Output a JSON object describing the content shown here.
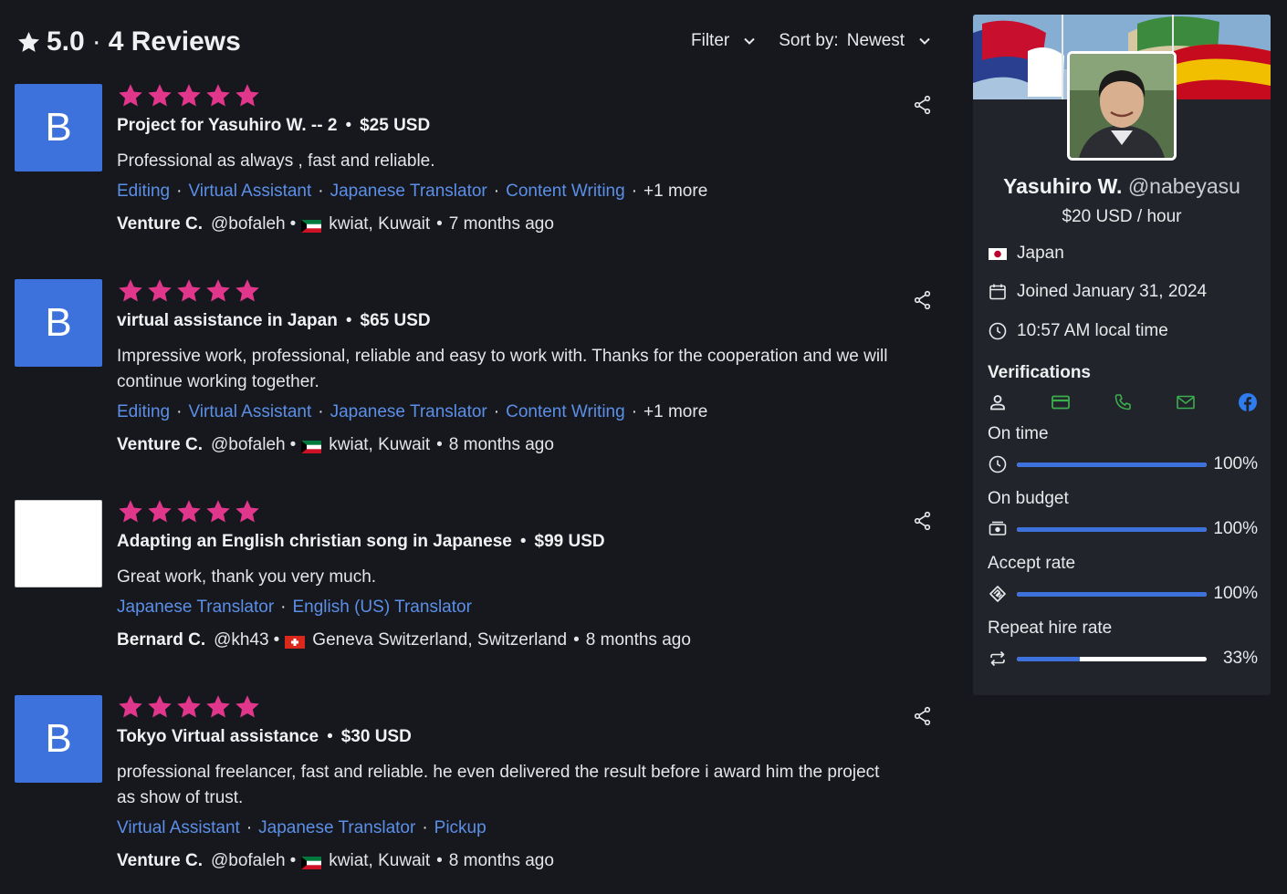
{
  "header": {
    "rating": "5.0",
    "separator": "·",
    "reviews_label": "4 Reviews",
    "filter_label": "Filter",
    "sort_label": "Sort by:",
    "sort_value": "Newest"
  },
  "colors": {
    "star": "#e0378c",
    "avatar_bg": "#3d72dd",
    "tag_link": "#5b8fe8",
    "bar_fill": "#3d72dd",
    "verify_green": "#3cae4e",
    "facebook_blue": "#2f7bf0"
  },
  "reviews": [
    {
      "avatar_letter": "B",
      "stars": 5,
      "title": "Project for Yasuhiro W. -- 2",
      "price": "$25 USD",
      "text": "Professional as always , fast and reliable.",
      "tags": [
        "Editing",
        "Virtual Assistant",
        "Japanese Translator",
        "Content Writing"
      ],
      "more": "+1 more",
      "reviewer": "Venture C.",
      "handle": "@bofaleh",
      "flag": "kuwait-flag",
      "location": "kwiat, Kuwait",
      "time": "7 months ago"
    },
    {
      "avatar_letter": "B",
      "stars": 5,
      "title": "virtual assistance in Japan",
      "price": "$65 USD",
      "text": "Impressive work, professional, reliable and easy to work with. Thanks for the cooperation and we will continue working together.",
      "tags": [
        "Editing",
        "Virtual Assistant",
        "Japanese Translator",
        "Content Writing"
      ],
      "more": "+1 more",
      "reviewer": "Venture C.",
      "handle": "@bofaleh",
      "flag": "kuwait-flag",
      "location": "kwiat, Kuwait",
      "time": "8 months ago"
    },
    {
      "avatar_letter": "",
      "stars": 5,
      "title": "Adapting an English christian song in Japanese",
      "price": "$99 USD",
      "text": "Great work, thank you very much.",
      "tags": [
        "Japanese Translator",
        "English (US) Translator"
      ],
      "more": "",
      "reviewer": "Bernard C.",
      "handle": "@kh43",
      "flag": "switzerland-flag",
      "location": "Geneva Switzerland, Switzerland",
      "time": "8 months ago"
    },
    {
      "avatar_letter": "B",
      "stars": 5,
      "title": "Tokyo Virtual assistance",
      "price": "$30 USD",
      "text": "professional freelancer, fast and reliable. he even delivered the result before i award him the project as show of trust.",
      "tags": [
        "Virtual Assistant",
        "Japanese Translator",
        "Pickup"
      ],
      "more": "",
      "reviewer": "Venture C.",
      "handle": "@bofaleh",
      "flag": "kuwait-flag",
      "location": "kwiat, Kuwait",
      "time": "8 months ago"
    }
  ],
  "profile": {
    "name": "Yasuhiro W.",
    "handle": "@nabeyasu",
    "rate": "$20 USD / hour",
    "country": "Japan",
    "joined": "Joined January 31, 2024",
    "local_time": "10:57 AM local time",
    "verifications_label": "Verifications",
    "verification_icons": [
      "user-icon",
      "credit-card-icon",
      "phone-icon",
      "email-icon",
      "facebook-icon"
    ],
    "stats": [
      {
        "label": "On time",
        "icon": "clock-icon",
        "value": 100,
        "display": "100%"
      },
      {
        "label": "On budget",
        "icon": "money-icon",
        "value": 100,
        "display": "100%"
      },
      {
        "label": "Accept rate",
        "icon": "handshake-icon",
        "value": 100,
        "display": "100%"
      },
      {
        "label": "Repeat hire rate",
        "icon": "repeat-icon",
        "value": 33,
        "display": "33%"
      }
    ]
  }
}
